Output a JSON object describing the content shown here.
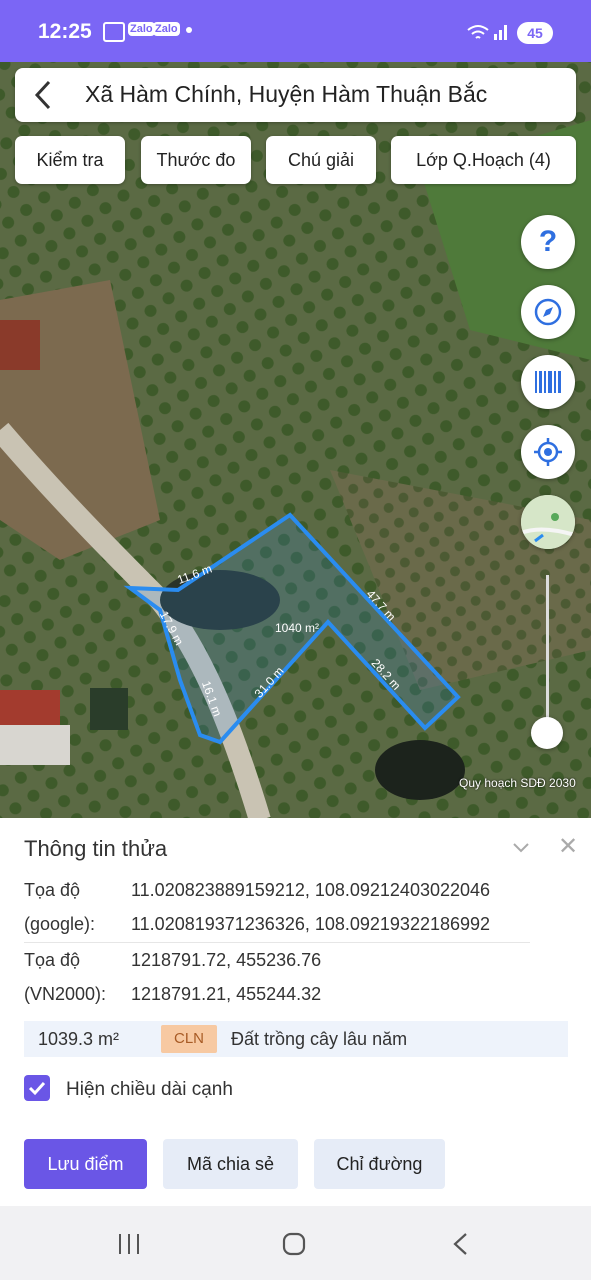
{
  "status_bar": {
    "time": "12:25",
    "apps": [
      "Zalo",
      "Zalo"
    ],
    "battery": "45"
  },
  "header": {
    "title": "Xã Hàm Chính, Huyện Hàm Thuận Bắc",
    "back_icon": "chevron-left-icon"
  },
  "chips": [
    "Kiểm tra",
    "Thước đo",
    "Chú giải",
    "Lớp Q.Hoạch (4)"
  ],
  "fabs": [
    "help-icon",
    "compass-icon",
    "barcode-icon",
    "locate-icon",
    "layer-thumbnail"
  ],
  "map": {
    "caption": "Quy hoạch SDĐ 2030",
    "parcel_area": "1040 m²",
    "edges": [
      "11.6 m",
      "47.7 m",
      "28.2 m",
      "31.0 m",
      "16.1 m",
      "17.9 m"
    ],
    "parcel_color": "#2a8cf0"
  },
  "panel": {
    "title": "Thông tin thửa",
    "coord_label_1": "Tọa độ",
    "coord_label_2": "(google):",
    "google_coord_1": "11.020823889159212, 108.09212403022046",
    "google_coord_2": "11.020819371236326, 108.09219322186992",
    "vn_label_1": "Tọa độ",
    "vn_label_2": "(VN2000):",
    "vn_coord_1": "1218791.72, 455236.76",
    "vn_coord_2": "1218791.21, 455244.32",
    "area": "1039.3 m²",
    "land_code": "CLN",
    "land_desc": "Đất trồng cây lâu năm",
    "show_edges_label": "Hiện chiều dài cạnh",
    "show_edges_checked": true,
    "buttons": {
      "save": "Lưu điểm",
      "share": "Mã chia sẻ",
      "directions": "Chỉ đường"
    }
  },
  "colors": {
    "accent": "#6a56e6",
    "statusbar": "#7b66f5"
  }
}
